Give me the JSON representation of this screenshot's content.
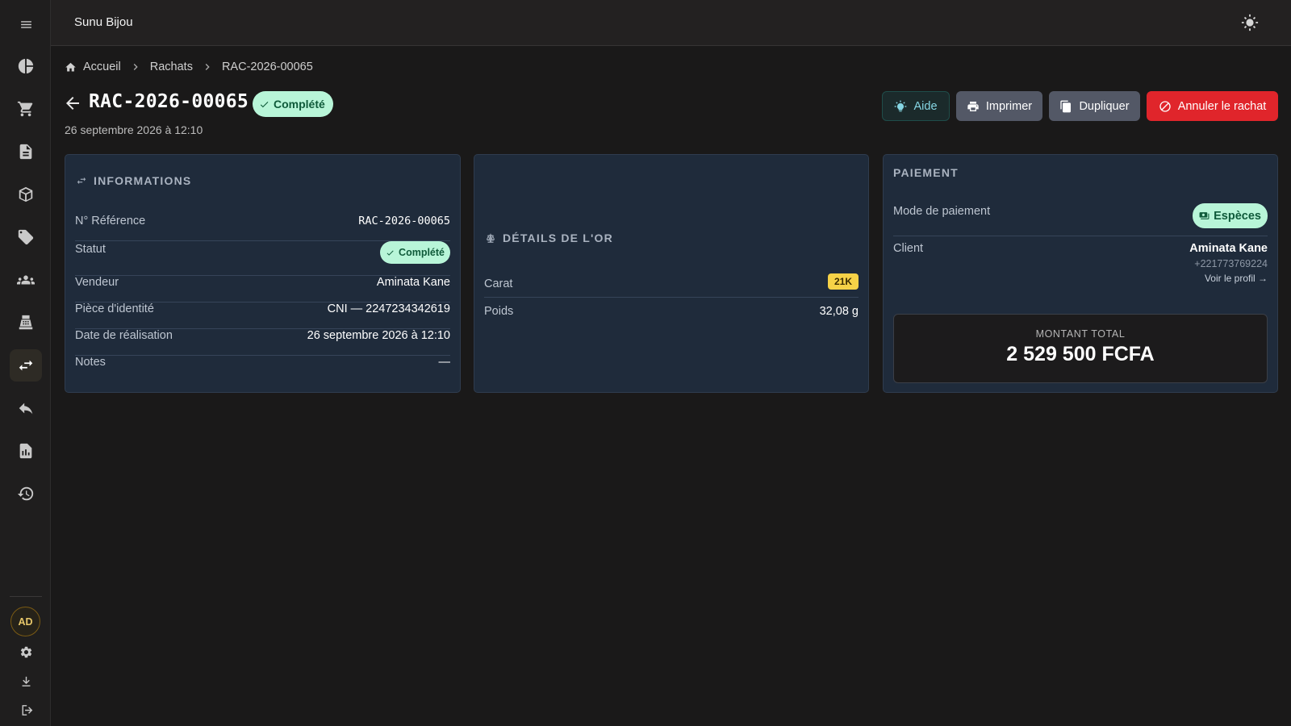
{
  "app": {
    "title": "Sunu Bijou"
  },
  "breadcrumb": {
    "home": "Accueil",
    "section": "Rachats",
    "current": "RAC-2026-00065"
  },
  "header": {
    "title": "RAC-2026-00065",
    "status": "Complété",
    "date": "26 septembre 2026 à 12:10"
  },
  "actions": {
    "help": "Aide",
    "print": "Imprimer",
    "duplicate": "Dupliquer",
    "cancel": "Annuler le rachat"
  },
  "user": {
    "initials": "AD"
  },
  "informations": {
    "title": "INFORMATIONS",
    "rows": [
      {
        "label": "N° Référence",
        "value": "RAC-2026-00065"
      },
      {
        "label": "Statut",
        "value": "Complété"
      },
      {
        "label": "Vendeur",
        "value": "Aminata Kane"
      },
      {
        "label": "Pièce d'identité",
        "value": "CNI — 2247234342619"
      },
      {
        "label": "Date de réalisation",
        "value": "26 septembre 2026 à 12:10"
      },
      {
        "label": "Notes",
        "value": "—"
      }
    ]
  },
  "gold": {
    "title": "DÉTAILS DE L'OR",
    "carat_label": "Carat",
    "carat_value": "21K",
    "weight_label": "Poids",
    "weight_value": "32,08 g"
  },
  "payment": {
    "title": "PAIEMENT",
    "mode_label": "Mode de paiement",
    "mode_value": "Espèces",
    "client_label": "Client",
    "client_name": "Aminata Kane",
    "client_phone": "+221773769224",
    "client_link": "Voir le profil →",
    "total_label": "MONTANT TOTAL",
    "total_value": "2 529 500 FCFA"
  },
  "colors": {
    "accent_success": "#b8f5d8",
    "danger": "#e0252b",
    "carat": "#f6d247",
    "card_bg": "#1f2b3b"
  }
}
